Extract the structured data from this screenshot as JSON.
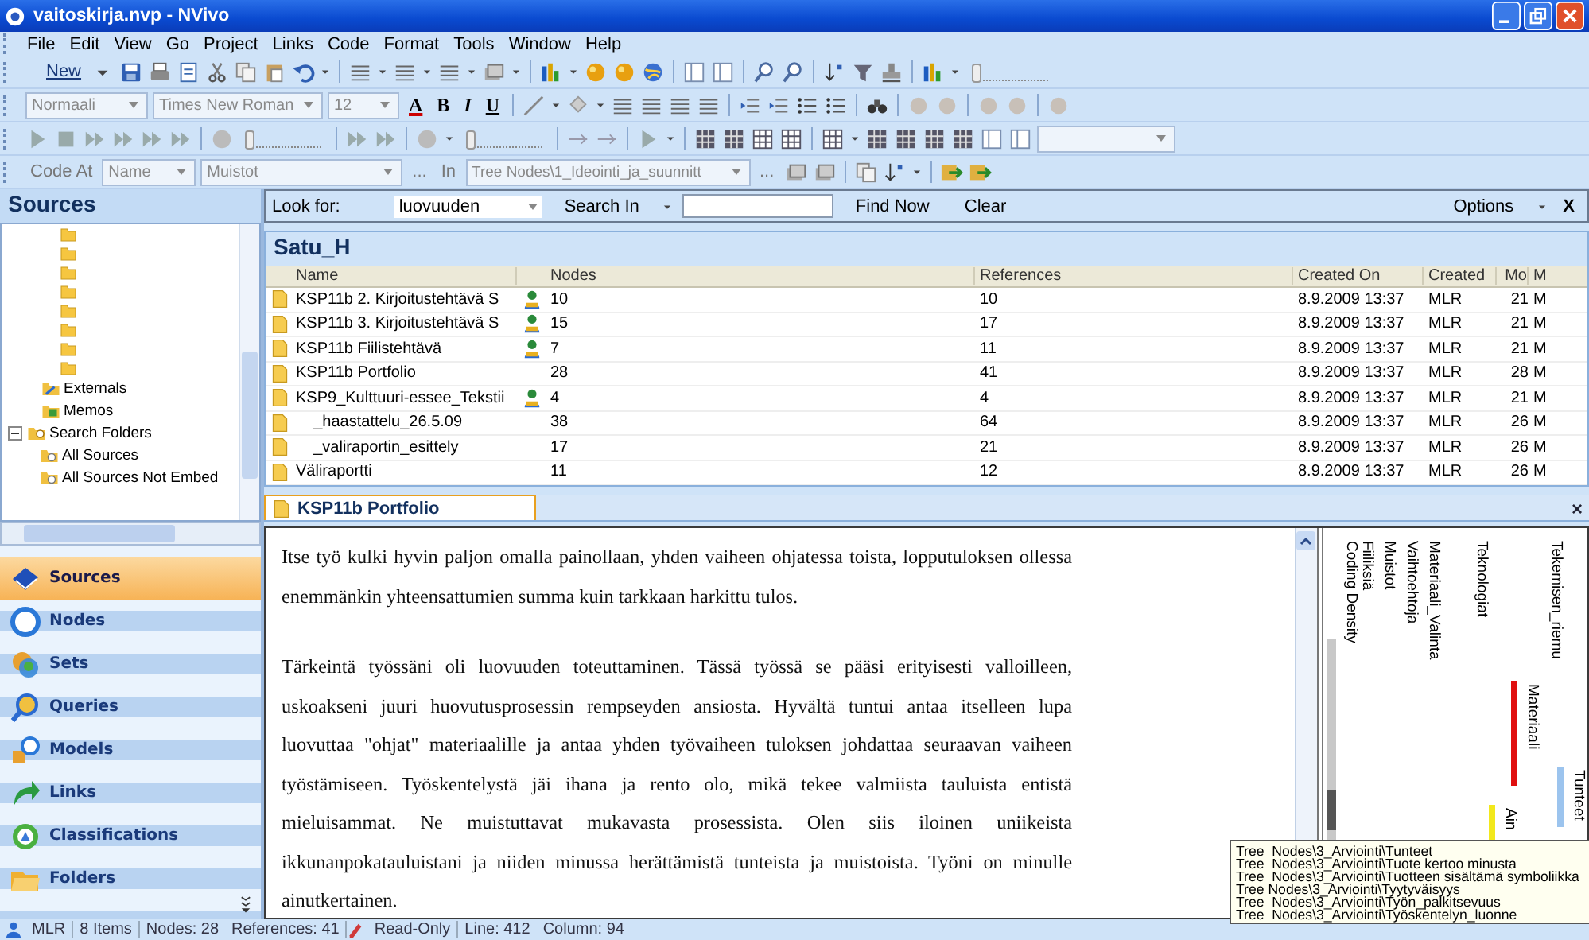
{
  "window": {
    "title": "vaitoskirja.nvp - NVivo"
  },
  "menu": [
    "File",
    "Edit",
    "View",
    "Go",
    "Project",
    "Links",
    "Code",
    "Format",
    "Tools",
    "Window",
    "Help"
  ],
  "toolbar": {
    "new_label": "New",
    "zoom_slider": {
      "level": 0
    },
    "style": "Normaali",
    "font": "Times New Roman",
    "size": "12",
    "format_letters": [
      "A",
      "B",
      "I",
      "U"
    ],
    "media_slider": {
      "level": 0
    },
    "volume_slider": {
      "level": 0
    },
    "code_at_label": "Code At",
    "code_at_field": "Name",
    "code_at_value": "Muistot",
    "more_1": "...",
    "in_label": "In",
    "in_value": "Tree Nodes\\1_Ideointi_ja_suunnitt",
    "more_2": "..."
  },
  "sidebar": {
    "title": "Sources",
    "tree": [
      {
        "label": "Externals",
        "kind": "externals"
      },
      {
        "label": "Memos",
        "kind": "memos"
      },
      {
        "label": "Search Folders",
        "kind": "search",
        "expanded": true,
        "children": [
          {
            "label": "All Sources",
            "kind": "search-folder"
          },
          {
            "label": "All Sources Not Embed",
            "kind": "search-folder"
          }
        ]
      }
    ],
    "nav": [
      {
        "label": "Sources",
        "selected": true
      },
      {
        "label": "Nodes",
        "selected": false
      },
      {
        "label": "Sets",
        "selected": false
      },
      {
        "label": "Queries",
        "selected": false
      },
      {
        "label": "Models",
        "selected": false
      },
      {
        "label": "Links",
        "selected": false
      },
      {
        "label": "Classifications",
        "selected": false
      },
      {
        "label": "Folders",
        "selected": false
      }
    ]
  },
  "find": {
    "look_for_label": "Look for:",
    "look_for_value": "luovuuden",
    "search_in": "Search In",
    "find_now": "Find Now",
    "clear": "Clear",
    "options": "Options",
    "close": "X"
  },
  "table": {
    "title": "Satu_H",
    "columns": [
      "Name",
      "Nodes",
      "References",
      "Created On",
      "Created",
      "Mo",
      "M"
    ],
    "rows": [
      {
        "name": "KSP11b 2. Kirjoitustehtävä S",
        "linked": true,
        "nodes": "10",
        "references": "10",
        "created_on": "8.9.2009 13:37",
        "created_by": "MLR",
        "mo": "21",
        "m": "M"
      },
      {
        "name": "KSP11b 3. Kirjoitustehtävä S",
        "linked": true,
        "nodes": "15",
        "references": "17",
        "created_on": "8.9.2009 13:37",
        "created_by": "MLR",
        "mo": "21",
        "m": "M"
      },
      {
        "name": "KSP11b Fiilistehtävä",
        "linked": true,
        "nodes": "7",
        "references": "11",
        "created_on": "8.9.2009 13:37",
        "created_by": "MLR",
        "mo": "21",
        "m": "M"
      },
      {
        "name": "KSP11b Portfolio",
        "linked": false,
        "nodes": "28",
        "references": "41",
        "created_on": "8.9.2009 13:37",
        "created_by": "MLR",
        "mo": "28",
        "m": "M"
      },
      {
        "name": "KSP9_Kulttuuri-essee_Tekstii",
        "linked": true,
        "nodes": "4",
        "references": "4",
        "created_on": "8.9.2009 13:37",
        "created_by": "MLR",
        "mo": "21",
        "m": "M"
      },
      {
        "name": "    _haastattelu_26.5.09",
        "linked": false,
        "nodes": "38",
        "references": "64",
        "created_on": "8.9.2009 13:37",
        "created_by": "MLR",
        "mo": "26",
        "m": "M"
      },
      {
        "name": "    _valiraportin_esittely",
        "linked": false,
        "nodes": "17",
        "references": "21",
        "created_on": "8.9.2009 13:37",
        "created_by": "MLR",
        "mo": "26",
        "m": "M"
      },
      {
        "name": "Väliraportti",
        "linked": false,
        "nodes": "11",
        "references": "12",
        "created_on": "8.9.2009 13:37",
        "created_by": "MLR",
        "mo": "26",
        "m": "M"
      }
    ]
  },
  "document": {
    "tab": "KSP11b Portfolio",
    "close": "×",
    "paragraphs": [
      "Itse työ kulki hyvin paljon omalla painollaan, yhden vaiheen ohjatessa toista, lopputuloksen ollessa enemmänkin yhteensattumien summa kuin tarkkaan harkittu tulos.",
      "Tärkeintä työssäni oli luovuuden toteuttaminen. Tässä työssä se pääsi erityisesti valloilleen, uskoakseni juuri huovutusprosessin rempseyden ansiosta. Hyvältä tuntui antaa itselleen lupa luovuttaa \"ohjat\" materiaalille ja antaa yhden työvaiheen tuloksen johdattaa seuraavan vaiheen työstämiseen. Työskentelystä jäi ihana ja rento olo, mikä tekee valmiista tauluista entistä mieluisammat. Ne muistuttavat mukavasta prosessista. Olen siis iloinen uniikeista ikkunanpokatauluistani ja niiden minussa herättämistä tunteista ja muistoista. Työni on minulle ainutkertainen."
    ]
  },
  "stripes": [
    {
      "label": "Coding Density",
      "kind": "density"
    },
    {
      "label": "Fiiliksiä",
      "kind": "node"
    },
    {
      "label": "Muistot",
      "kind": "node"
    },
    {
      "label": "Vaihtoehtoja",
      "kind": "node"
    },
    {
      "label": "Materiaali_Valinta",
      "kind": "node"
    },
    {
      "label": "Teknologiat",
      "kind": "node"
    },
    {
      "label": "Ain",
      "kind": "coded",
      "color": "#f2e81c"
    },
    {
      "label": "Materiaali",
      "kind": "coded",
      "color": "#e01010"
    },
    {
      "label": "Tekemisen_riemu",
      "kind": "node"
    },
    {
      "label": "Tunteet",
      "kind": "coded",
      "color": "#9cc4ee"
    }
  ],
  "tooltip": [
    "Tree  Nodes\\3_Arviointi\\Tunteet",
    "Tree  Nodes\\3_Arviointi\\Tuote kertoo minusta",
    "Tree  Nodes\\3_Arviointi\\Tuotteen sisältämä symboliikka",
    "Tree Nodes\\3_Arviointi\\Tyytyväisyys",
    "Tree  Nodes\\3_Arviointi\\Työn_palkitsevuus",
    "Tree  Nodes\\3_Arviointi\\Työskentelyn_luonne"
  ],
  "status_bar": {
    "user": "MLR",
    "items": "8 Items",
    "nodes": "Nodes: 28",
    "references": "References: 41",
    "mode": "Read-Only",
    "line": "Line: 412",
    "column": "Column: 94"
  }
}
